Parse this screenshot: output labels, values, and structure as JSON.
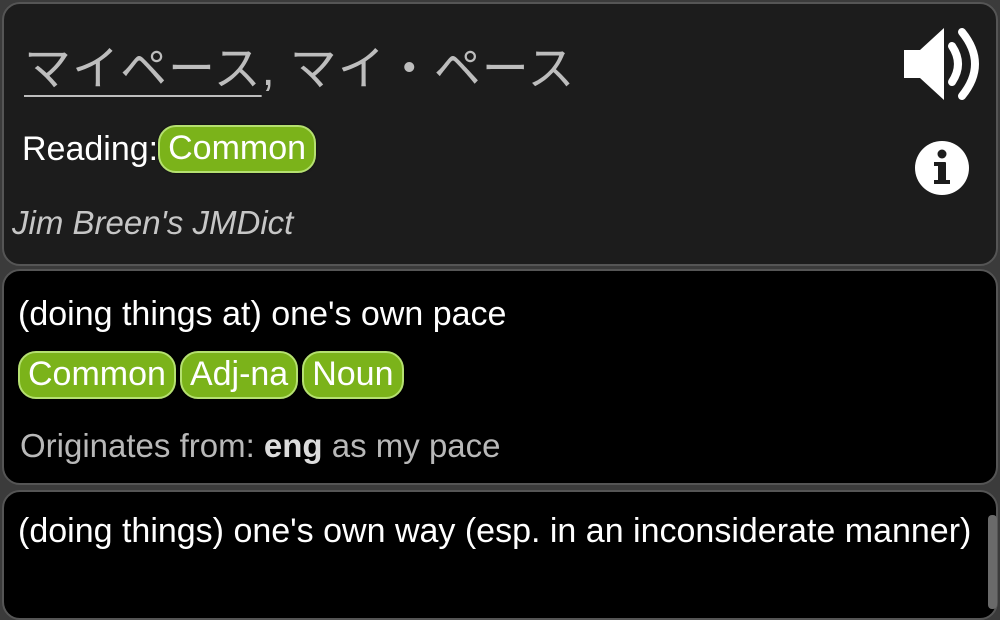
{
  "entry": {
    "headword_primary": "マイペース",
    "headword_separator": ",",
    "headword_alt": "マイ・ペース",
    "reading_label": "Reading:",
    "reading_tag": "Common",
    "source": "Jim Breen's JMDict",
    "sound_icon": "speaker-icon",
    "info_icon": "info-icon"
  },
  "senses": [
    {
      "gloss": "(doing things at) one's own pace",
      "tags": [
        "Common",
        "Adj-na",
        "Noun"
      ],
      "origin_label": "Originates from:",
      "origin_lang": "eng",
      "origin_word": "as my pace"
    },
    {
      "gloss": "(doing things) one's own way (esp. in an inconsiderate manner)"
    }
  ],
  "colors": {
    "tag_bg": "#7bb31a",
    "tag_border": "#b5e070",
    "card_bg_header": "#1c1c1c",
    "card_bg_sense": "#000000"
  }
}
